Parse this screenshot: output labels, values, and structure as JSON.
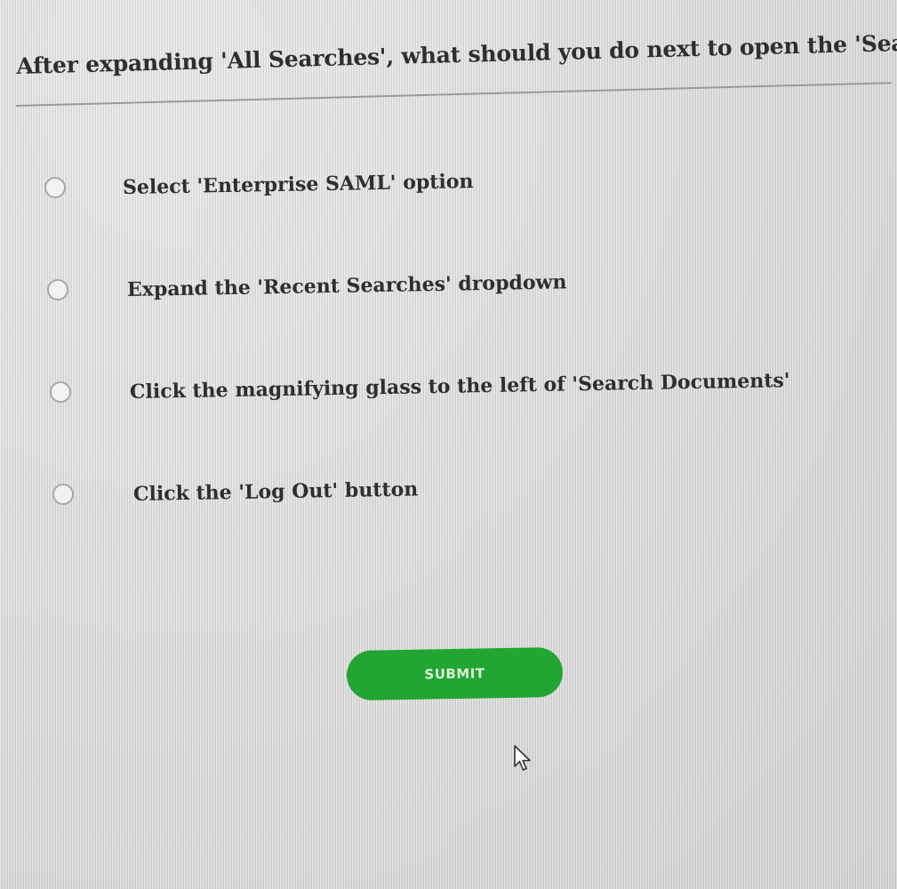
{
  "question": {
    "text": "After expanding 'All Searches', what should you do next to open the 'Search View'?"
  },
  "options": [
    {
      "label": "Select 'Enterprise SAML' option",
      "selected": false
    },
    {
      "label": "Expand the 'Recent Searches' dropdown",
      "selected": false
    },
    {
      "label": "Click the magnifying glass to the left of 'Search Documents'",
      "selected": false
    },
    {
      "label": "Click the 'Log Out' button",
      "selected": false
    }
  ],
  "submit": {
    "label": "SUBMIT"
  },
  "colors": {
    "submit_bg": "#22a533",
    "submit_text": "#d9f0d5",
    "page_bg": "#dcdcdc"
  },
  "icons": {
    "cursor": "mouse-pointer-icon",
    "radio": "radio-button-icon"
  }
}
